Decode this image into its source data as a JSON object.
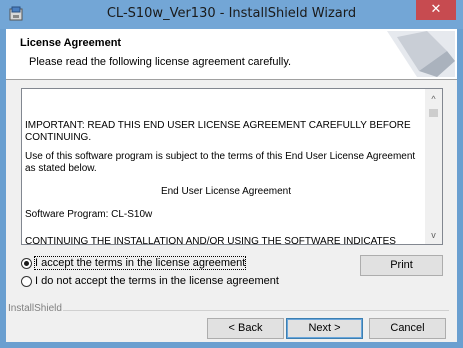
{
  "window": {
    "title": "CL-S10w_Ver130 - InstallShield Wizard",
    "close_glyph": "✕"
  },
  "header": {
    "title": "License Agreement",
    "subtitle": "Please read the following license agreement carefully."
  },
  "license": {
    "paragraphs": [
      "IMPORTANT: READ THIS END USER LICENSE AGREEMENT CAREFULLY BEFORE CONTINUING.",
      "Use of this software program is subject to the terms of this End User License Agreement as stated below.",
      "End User License Agreement",
      "Software Program: CL-S10w",
      "CONTINUING THE INSTALLATION AND/OR USING THE SOFTWARE INDICATES YOUR"
    ],
    "scroll_up_glyph": "^",
    "scroll_down_glyph": "v"
  },
  "options": {
    "accept_label_pre": "",
    "accept_label": "I accept the terms in the license agreement",
    "decline_label": "I do not accept the terms in the license agreement",
    "selected": "accept"
  },
  "buttons": {
    "print": "Print",
    "back": "< Back",
    "next": "Next >",
    "cancel": "Cancel"
  },
  "footer": {
    "brand": "InstallShield"
  },
  "colors": {
    "titlebar": "#73a6d6",
    "close": "#c74b50"
  },
  "icons": {
    "app": "installer-icon",
    "header_graphic": "installshield-graphic-icon"
  }
}
